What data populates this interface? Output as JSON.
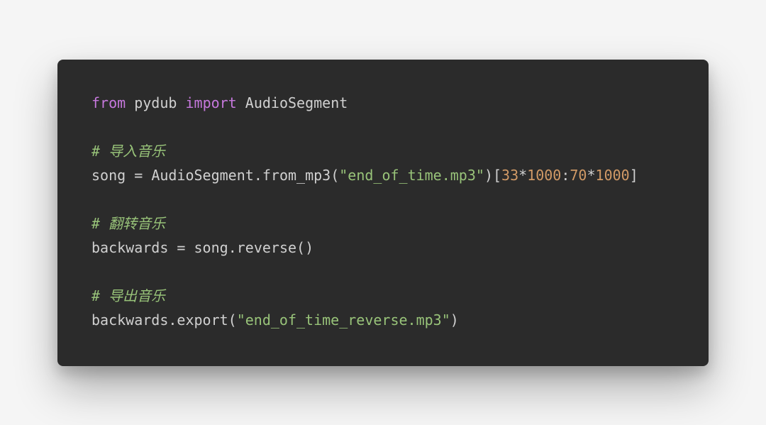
{
  "code": {
    "l1": {
      "kw_from": "from",
      "mod": "pydub",
      "kw_import": "import",
      "name": "AudioSegment"
    },
    "l3_comment": "# 导入音乐",
    "l4": {
      "lhs": "song",
      "eq": "=",
      "cls": "AudioSegment",
      "dot1": ".",
      "fn": "from_mp3",
      "lp": "(",
      "str": "\"end_of_time.mp3\"",
      "rp": ")",
      "lb": "[",
      "n1": "33",
      "mul1": "*",
      "n2": "1000",
      "colon": ":",
      "n3": "70",
      "mul2": "*",
      "n4": "1000",
      "rb": "]"
    },
    "l6_comment": "# 翻转音乐",
    "l7": {
      "lhs": "backwards",
      "eq": "=",
      "obj": "song",
      "dot": ".",
      "fn": "reverse",
      "parens": "()"
    },
    "l9_comment": "# 导出音乐",
    "l10": {
      "obj": "backwards",
      "dot": ".",
      "fn": "export",
      "lp": "(",
      "str": "\"end_of_time_reverse.mp3\"",
      "rp": ")"
    }
  }
}
